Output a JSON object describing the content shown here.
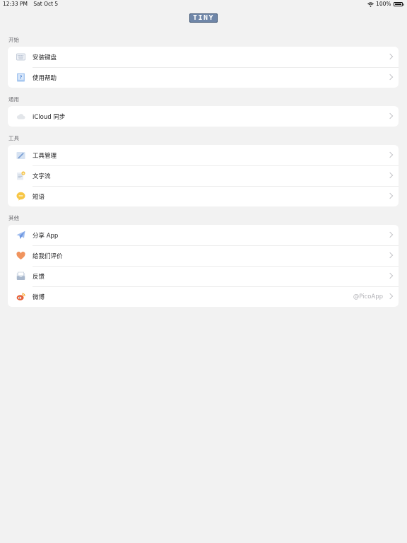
{
  "status_bar": {
    "time": "12:33 PM",
    "date": "Sat Oct 5",
    "battery": "100%",
    "wifi_icon": "wifi-icon",
    "battery_icon": "battery-icon"
  },
  "header": {
    "logo_text": "TINY"
  },
  "sections": [
    {
      "label": "开始",
      "items": [
        {
          "icon": "keyboard-icon",
          "label": "安装键盘"
        },
        {
          "icon": "help-book-icon",
          "label": "使用帮助"
        }
      ]
    },
    {
      "label": "通用",
      "items": [
        {
          "icon": "cloud-icon",
          "label": "iCloud 同步"
        }
      ]
    },
    {
      "label": "工具",
      "items": [
        {
          "icon": "tools-icon",
          "label": "工具管理"
        },
        {
          "icon": "text-flow-icon",
          "label": "文字流"
        },
        {
          "icon": "chat-bubble-icon",
          "label": "短语"
        }
      ]
    },
    {
      "label": "其他",
      "items": [
        {
          "icon": "paper-plane-icon",
          "label": "分享 App"
        },
        {
          "icon": "heart-icon",
          "label": "给我们评价"
        },
        {
          "icon": "mail-tray-icon",
          "label": "反馈"
        },
        {
          "icon": "weibo-icon",
          "label": "微博",
          "detail": "@PicoApp"
        }
      ]
    }
  ],
  "colors": {
    "background": "#f2f2f2",
    "card": "#ffffff",
    "accent": "#6f86a8"
  }
}
